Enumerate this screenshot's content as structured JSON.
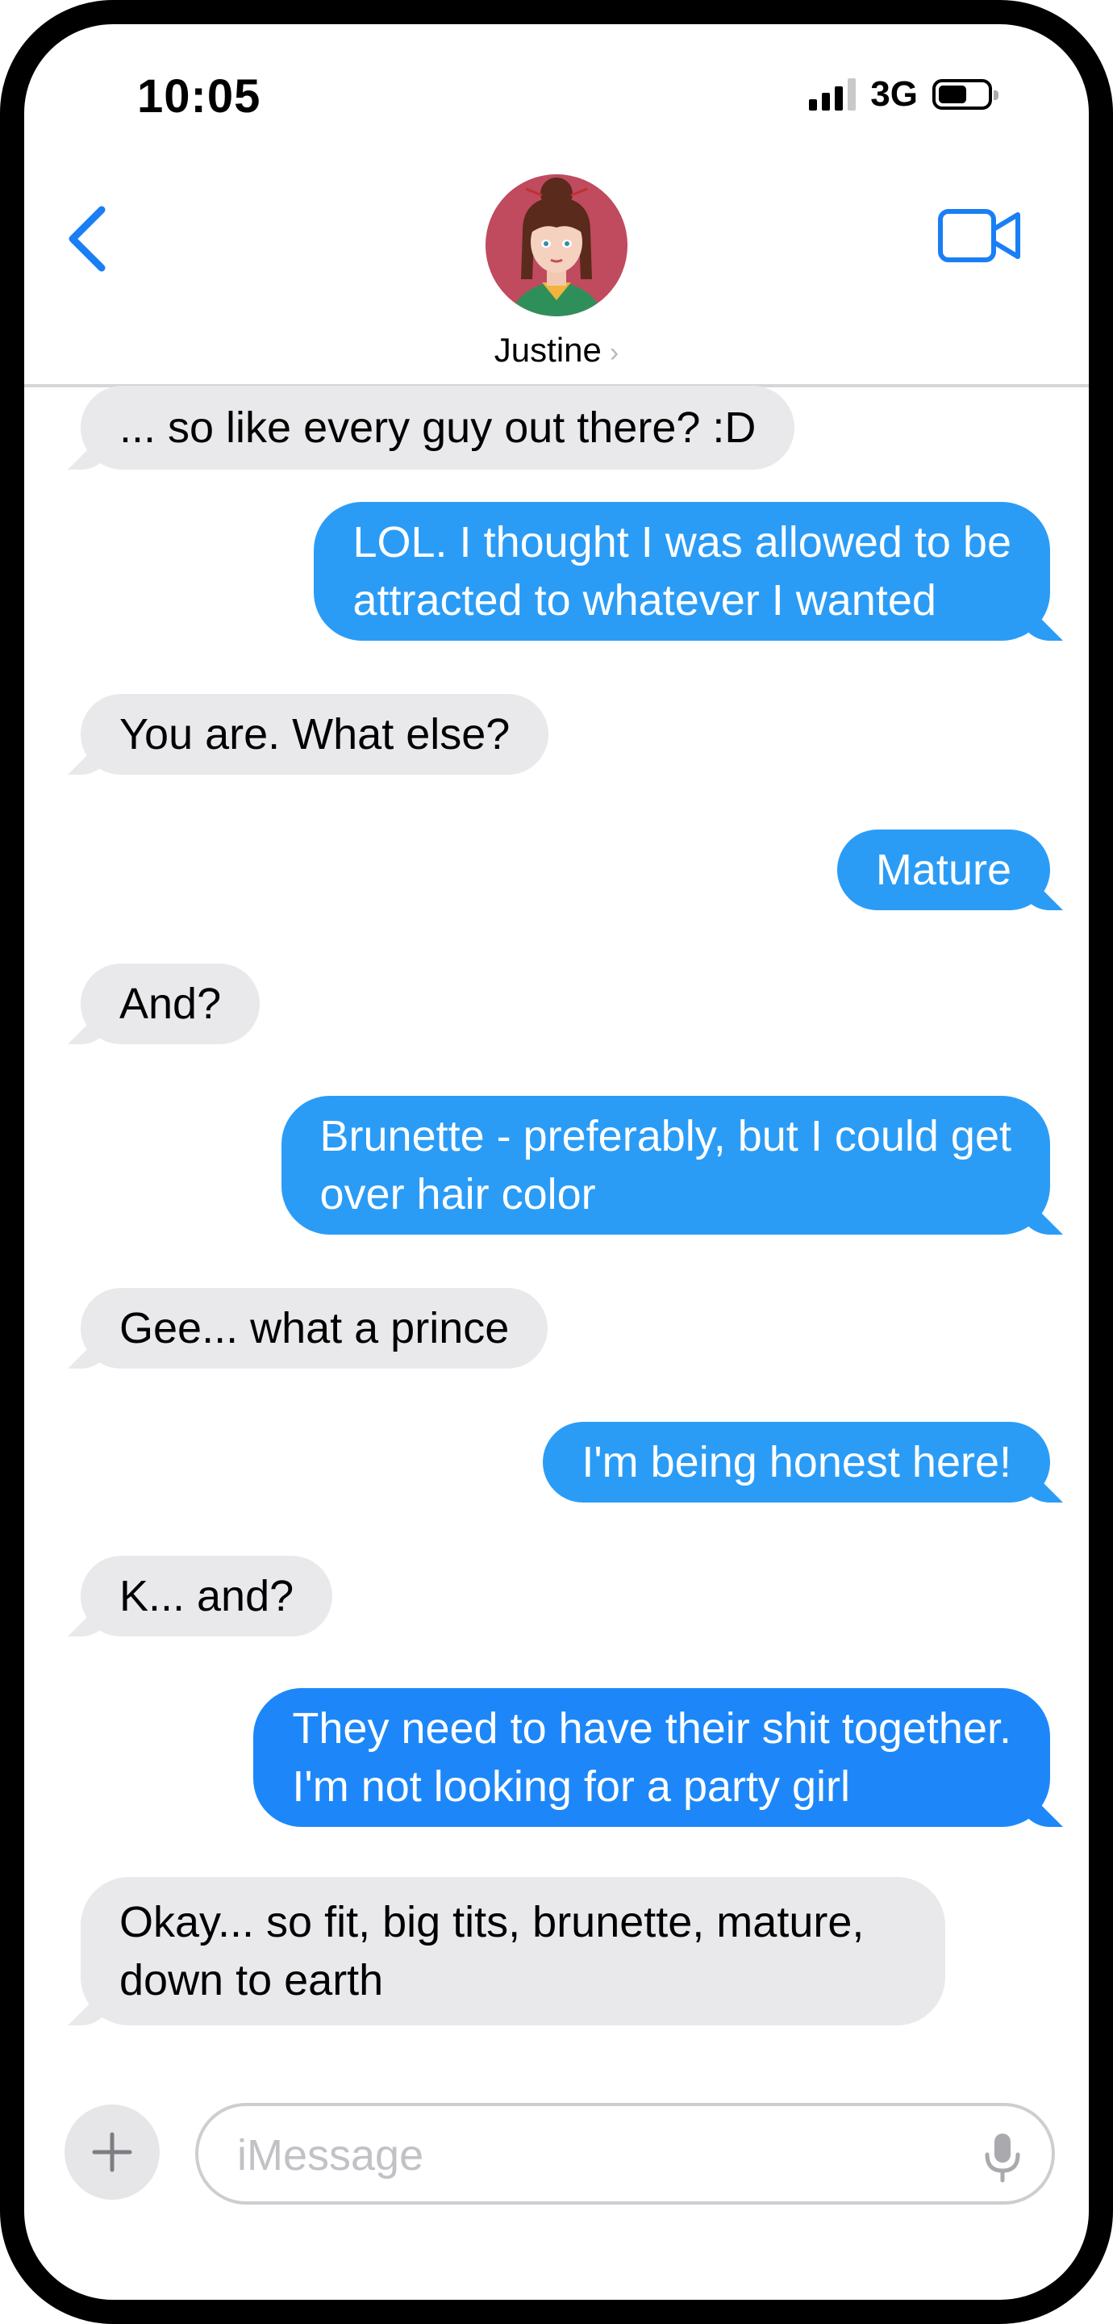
{
  "status_bar": {
    "time": "10:05",
    "network": "3G"
  },
  "header": {
    "contact_name": "Justine",
    "chevron": "›"
  },
  "messages": [
    {
      "side": "in",
      "text_lines": [
        "... so like every guy out there? :D"
      ]
    },
    {
      "side": "out",
      "text_lines": [
        "LOL.  I thought I was allowed to be",
        "attracted to whatever I wanted"
      ]
    },
    {
      "side": "in",
      "text_lines": [
        "You are.  What else?"
      ]
    },
    {
      "side": "out",
      "text_lines": [
        "Mature"
      ]
    },
    {
      "side": "in",
      "text_lines": [
        "And?"
      ]
    },
    {
      "side": "out",
      "text_lines": [
        "Brunette - preferably, but I could get",
        "over hair color"
      ]
    },
    {
      "side": "in",
      "text_lines": [
        "Gee... what a prince"
      ]
    },
    {
      "side": "out",
      "text_lines": [
        "I'm being honest here!"
      ]
    },
    {
      "side": "in",
      "text_lines": [
        "K... and?"
      ]
    },
    {
      "side": "out",
      "text_lines": [
        "They need to have their shit together.",
        "I'm not looking for a party girl"
      ]
    },
    {
      "side": "in",
      "text_lines": [
        "Okay... so fit, big tits, brunette, mature,",
        "down to earth"
      ]
    }
  ],
  "composer": {
    "placeholder": "iMessage",
    "plus_label": "+"
  },
  "colors": {
    "incoming": "#e9e9eb",
    "outgoing": "#2b9cf6",
    "accent": "#1a7ef5"
  },
  "icons": [
    "back-chevron-icon",
    "video-camera-icon",
    "plus-icon",
    "microphone-icon",
    "signal-icon",
    "battery-icon"
  ]
}
